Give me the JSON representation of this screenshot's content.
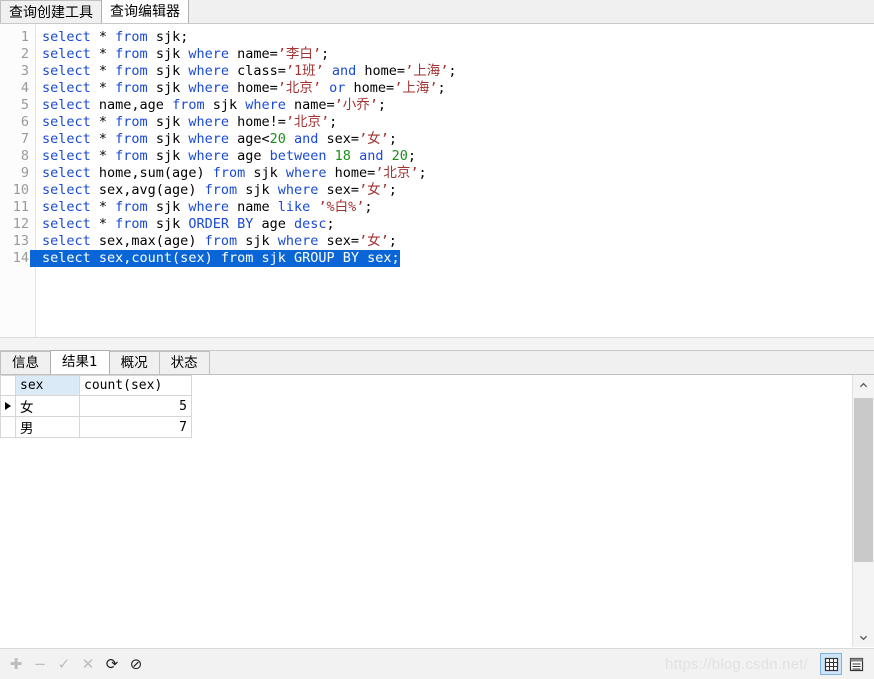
{
  "top_tabs": [
    {
      "label": "查询创建工具",
      "active": false
    },
    {
      "label": "查询编辑器",
      "active": true
    }
  ],
  "editor": {
    "lines": [
      {
        "no": "1",
        "selected": false,
        "tokens": [
          {
            "t": "select",
            "c": "kw"
          },
          {
            "t": " * ",
            "c": "op"
          },
          {
            "t": "from",
            "c": "kw"
          },
          {
            "t": " sjk;",
            "c": "op"
          }
        ]
      },
      {
        "no": "2",
        "selected": false,
        "tokens": [
          {
            "t": "select",
            "c": "kw"
          },
          {
            "t": " * ",
            "c": "op"
          },
          {
            "t": "from",
            "c": "kw"
          },
          {
            "t": " sjk ",
            "c": "op"
          },
          {
            "t": "where",
            "c": "kw"
          },
          {
            "t": " name=",
            "c": "op"
          },
          {
            "t": "’李白’",
            "c": "str"
          },
          {
            "t": ";",
            "c": "op"
          }
        ]
      },
      {
        "no": "3",
        "selected": false,
        "tokens": [
          {
            "t": "select",
            "c": "kw"
          },
          {
            "t": " * ",
            "c": "op"
          },
          {
            "t": "from",
            "c": "kw"
          },
          {
            "t": " sjk ",
            "c": "op"
          },
          {
            "t": "where",
            "c": "kw"
          },
          {
            "t": " class=",
            "c": "op"
          },
          {
            "t": "’1班’",
            "c": "str"
          },
          {
            "t": " ",
            "c": "op"
          },
          {
            "t": "and",
            "c": "kw"
          },
          {
            "t": " home=",
            "c": "op"
          },
          {
            "t": "’上海’",
            "c": "str"
          },
          {
            "t": ";",
            "c": "op"
          }
        ]
      },
      {
        "no": "4",
        "selected": false,
        "tokens": [
          {
            "t": "select",
            "c": "kw"
          },
          {
            "t": " * ",
            "c": "op"
          },
          {
            "t": "from",
            "c": "kw"
          },
          {
            "t": " sjk ",
            "c": "op"
          },
          {
            "t": "where",
            "c": "kw"
          },
          {
            "t": " home=",
            "c": "op"
          },
          {
            "t": "’北京’",
            "c": "str"
          },
          {
            "t": " ",
            "c": "op"
          },
          {
            "t": "or",
            "c": "kw"
          },
          {
            "t": " home=",
            "c": "op"
          },
          {
            "t": "’上海’",
            "c": "str"
          },
          {
            "t": ";",
            "c": "op"
          }
        ]
      },
      {
        "no": "5",
        "selected": false,
        "tokens": [
          {
            "t": "select",
            "c": "kw"
          },
          {
            "t": " name,age ",
            "c": "op"
          },
          {
            "t": "from",
            "c": "kw"
          },
          {
            "t": " sjk ",
            "c": "op"
          },
          {
            "t": "where",
            "c": "kw"
          },
          {
            "t": " name=",
            "c": "op"
          },
          {
            "t": "’小乔’",
            "c": "str"
          },
          {
            "t": ";",
            "c": "op"
          }
        ]
      },
      {
        "no": "6",
        "selected": false,
        "tokens": [
          {
            "t": "select",
            "c": "kw"
          },
          {
            "t": " * ",
            "c": "op"
          },
          {
            "t": "from",
            "c": "kw"
          },
          {
            "t": " sjk ",
            "c": "op"
          },
          {
            "t": "where",
            "c": "kw"
          },
          {
            "t": " home!=",
            "c": "op"
          },
          {
            "t": "’北京’",
            "c": "str"
          },
          {
            "t": ";",
            "c": "op"
          }
        ]
      },
      {
        "no": "7",
        "selected": false,
        "tokens": [
          {
            "t": "select",
            "c": "kw"
          },
          {
            "t": " * ",
            "c": "op"
          },
          {
            "t": "from",
            "c": "kw"
          },
          {
            "t": " sjk ",
            "c": "op"
          },
          {
            "t": "where",
            "c": "kw"
          },
          {
            "t": " age<",
            "c": "op"
          },
          {
            "t": "20",
            "c": "num"
          },
          {
            "t": " ",
            "c": "op"
          },
          {
            "t": "and",
            "c": "kw"
          },
          {
            "t": " sex=",
            "c": "op"
          },
          {
            "t": "’女’",
            "c": "str"
          },
          {
            "t": ";",
            "c": "op"
          }
        ]
      },
      {
        "no": "8",
        "selected": false,
        "tokens": [
          {
            "t": "select",
            "c": "kw"
          },
          {
            "t": " * ",
            "c": "op"
          },
          {
            "t": "from",
            "c": "kw"
          },
          {
            "t": " sjk ",
            "c": "op"
          },
          {
            "t": "where",
            "c": "kw"
          },
          {
            "t": " age ",
            "c": "op"
          },
          {
            "t": "between",
            "c": "kw"
          },
          {
            "t": " ",
            "c": "op"
          },
          {
            "t": "18",
            "c": "num"
          },
          {
            "t": " ",
            "c": "op"
          },
          {
            "t": "and",
            "c": "kw"
          },
          {
            "t": " ",
            "c": "op"
          },
          {
            "t": "20",
            "c": "num"
          },
          {
            "t": ";",
            "c": "op"
          }
        ]
      },
      {
        "no": "9",
        "selected": false,
        "tokens": [
          {
            "t": "select",
            "c": "kw"
          },
          {
            "t": " home,sum(age) ",
            "c": "op"
          },
          {
            "t": "from",
            "c": "kw"
          },
          {
            "t": " sjk ",
            "c": "op"
          },
          {
            "t": "where",
            "c": "kw"
          },
          {
            "t": " home=",
            "c": "op"
          },
          {
            "t": "’北京’",
            "c": "str"
          },
          {
            "t": ";",
            "c": "op"
          }
        ]
      },
      {
        "no": "10",
        "selected": false,
        "tokens": [
          {
            "t": "select",
            "c": "kw"
          },
          {
            "t": " sex,avg(age) ",
            "c": "op"
          },
          {
            "t": "from",
            "c": "kw"
          },
          {
            "t": " sjk ",
            "c": "op"
          },
          {
            "t": "where",
            "c": "kw"
          },
          {
            "t": " sex=",
            "c": "op"
          },
          {
            "t": "’女’",
            "c": "str"
          },
          {
            "t": ";",
            "c": "op"
          }
        ]
      },
      {
        "no": "11",
        "selected": false,
        "tokens": [
          {
            "t": "select",
            "c": "kw"
          },
          {
            "t": " * ",
            "c": "op"
          },
          {
            "t": "from",
            "c": "kw"
          },
          {
            "t": " sjk ",
            "c": "op"
          },
          {
            "t": "where",
            "c": "kw"
          },
          {
            "t": " name ",
            "c": "op"
          },
          {
            "t": "like",
            "c": "kw"
          },
          {
            "t": " ",
            "c": "op"
          },
          {
            "t": "’%白%’",
            "c": "str"
          },
          {
            "t": ";",
            "c": "op"
          }
        ]
      },
      {
        "no": "12",
        "selected": false,
        "tokens": [
          {
            "t": "select",
            "c": "kw"
          },
          {
            "t": " * ",
            "c": "op"
          },
          {
            "t": "from",
            "c": "kw"
          },
          {
            "t": " sjk ",
            "c": "op"
          },
          {
            "t": "ORDER BY",
            "c": "kw"
          },
          {
            "t": " age ",
            "c": "op"
          },
          {
            "t": "desc",
            "c": "kw"
          },
          {
            "t": ";",
            "c": "op"
          }
        ]
      },
      {
        "no": "13",
        "selected": false,
        "tokens": [
          {
            "t": "select",
            "c": "kw"
          },
          {
            "t": " sex,max(age) ",
            "c": "op"
          },
          {
            "t": "from",
            "c": "kw"
          },
          {
            "t": " sjk ",
            "c": "op"
          },
          {
            "t": "where",
            "c": "kw"
          },
          {
            "t": " sex=",
            "c": "op"
          },
          {
            "t": "’女’",
            "c": "str"
          },
          {
            "t": ";",
            "c": "op"
          }
        ]
      },
      {
        "no": "14",
        "selected": true,
        "tokens": [
          {
            "t": "select",
            "c": "kw"
          },
          {
            "t": " sex,count(sex) ",
            "c": "op"
          },
          {
            "t": "from",
            "c": "kw"
          },
          {
            "t": " sjk ",
            "c": "op"
          },
          {
            "t": "GROUP BY",
            "c": "kw"
          },
          {
            "t": " sex;",
            "c": "op"
          }
        ]
      }
    ]
  },
  "result_tabs": [
    {
      "label": "信息",
      "active": false
    },
    {
      "label": "结果1",
      "active": true
    },
    {
      "label": "概况",
      "active": false
    },
    {
      "label": "状态",
      "active": false
    }
  ],
  "result_grid": {
    "columns": [
      "sex",
      "count(sex)"
    ],
    "rows": [
      {
        "current": true,
        "sex": "女",
        "count": "5"
      },
      {
        "current": false,
        "sex": "男",
        "count": "7"
      }
    ]
  },
  "bottom_toolbar": {
    "icons": [
      {
        "name": "add-record-icon",
        "glyph": "✚",
        "enabled": false
      },
      {
        "name": "remove-record-icon",
        "glyph": "−",
        "enabled": false
      },
      {
        "name": "confirm-icon",
        "glyph": "✓",
        "enabled": false
      },
      {
        "name": "cancel-icon",
        "glyph": "✕",
        "enabled": false
      },
      {
        "name": "refresh-icon",
        "glyph": "⟳",
        "enabled": true
      },
      {
        "name": "stop-icon",
        "glyph": "⊘",
        "enabled": true
      }
    ],
    "watermark": "https://blog.csdn.net/",
    "view_modes": [
      {
        "name": "grid-view-button",
        "selected": true
      },
      {
        "name": "form-view-button",
        "selected": false
      }
    ]
  },
  "colors": {
    "keyword": "#1a4ad6",
    "string": "#a33232",
    "number": "#1b8f1b",
    "selection": "#0a66d6",
    "header_highlight": "#dbeaf7"
  }
}
